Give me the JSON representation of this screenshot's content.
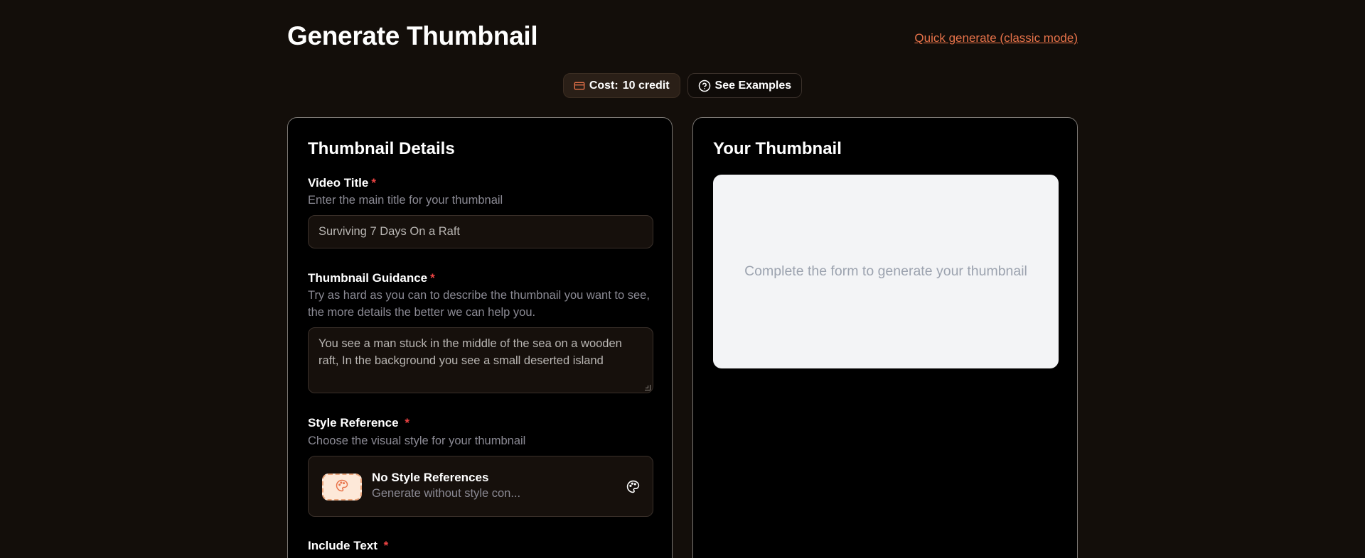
{
  "header": {
    "title": "Generate Thumbnail",
    "quick_link": "Quick generate (classic mode)"
  },
  "pills": {
    "cost_label": "Cost:",
    "cost_value": "10 credit",
    "examples_label": "See Examples"
  },
  "form": {
    "title": "Thumbnail Details",
    "video_title": {
      "label": "Video Title",
      "required": "*",
      "help": "Enter the main title for your thumbnail",
      "value": "Surviving 7 Days On a Raft"
    },
    "guidance": {
      "label": "Thumbnail Guidance",
      "required": "*",
      "help": "Try as hard as you can to describe the thumbnail you want to see, the more details the better we can help you.",
      "value": "You see a man stuck in the middle of the sea on a wooden raft, In the background you see a small deserted island"
    },
    "style_reference": {
      "label": "Style Reference",
      "required": "*",
      "help": "Choose the visual style for your thumbnail",
      "option_title": "No Style References",
      "option_desc": "Generate without style con..."
    },
    "include_text": {
      "label": "Include Text",
      "required": "*"
    }
  },
  "preview": {
    "title": "Your Thumbnail",
    "placeholder": "Complete the form to generate your thumbnail"
  },
  "colors": {
    "background": "#130e0a",
    "accent": "#e8734a",
    "required": "#ef4444",
    "card": "#000000"
  },
  "icons": [
    "credit-card-icon",
    "help-circle-icon",
    "palette-icon"
  ]
}
